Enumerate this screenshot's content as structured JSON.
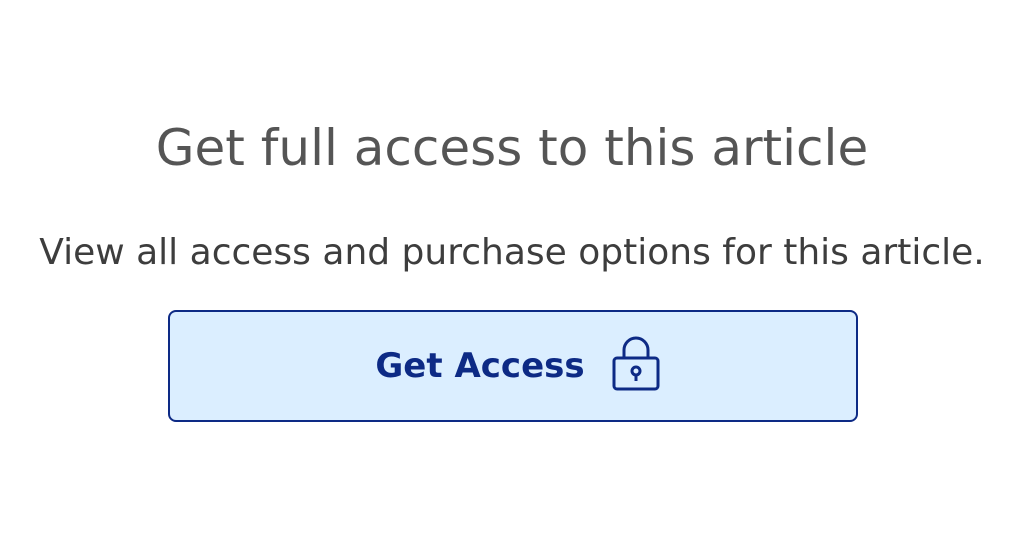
{
  "paywall": {
    "heading": "Get full access to this article",
    "description": "View all access and purchase options for this article.",
    "button_label": "Get Access",
    "button_icon": "lock-icon"
  },
  "colors": {
    "heading_text": "#555555",
    "body_text": "#3d3d3d",
    "button_background": "#dbeeff",
    "button_border": "#0d2a85",
    "button_text": "#0d2a85"
  }
}
